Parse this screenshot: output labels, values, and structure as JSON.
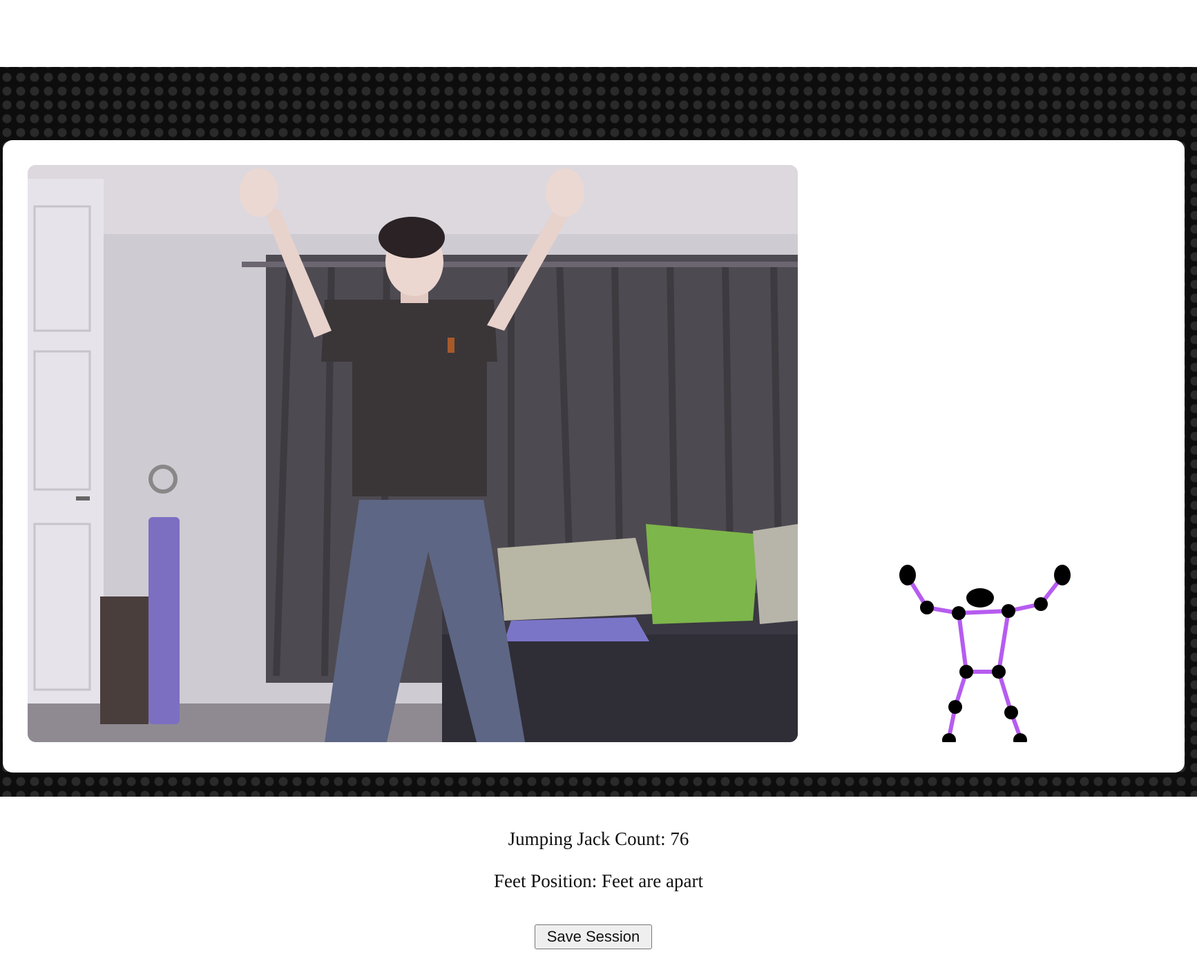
{
  "stats": {
    "count_label": "Jumping Jack Count: 76",
    "feet_label": "Feet Position: Feet are apart"
  },
  "actions": {
    "save_label": "Save Session"
  },
  "colors": {
    "band": "#0d0d0d",
    "panel": "#ffffff",
    "skeleton_bone": "#b65cf0",
    "skeleton_joint": "#000000"
  },
  "icons": {
    "camera_feed": "webcam-feed",
    "pose": "pose-skeleton"
  }
}
